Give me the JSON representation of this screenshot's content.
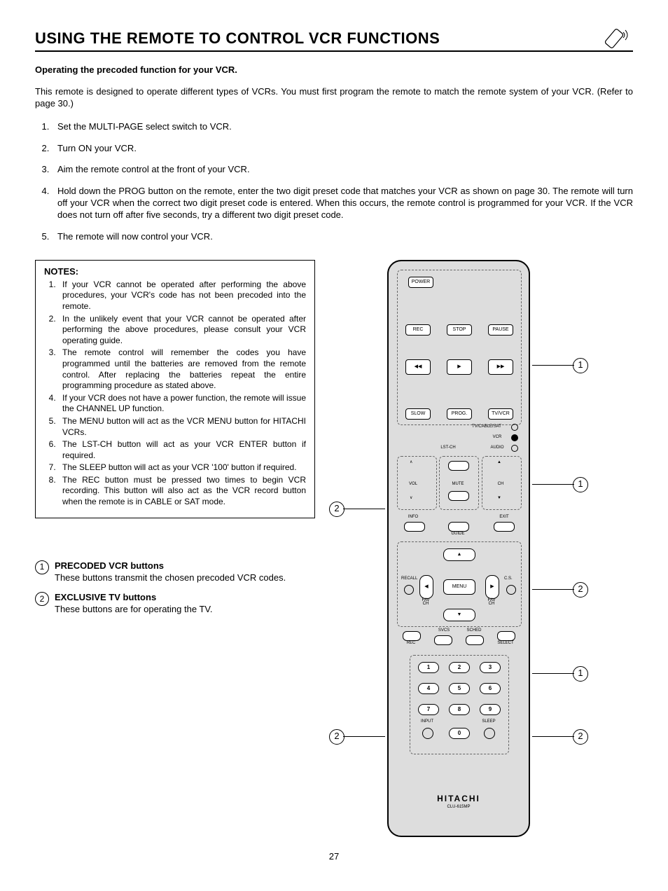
{
  "title": "USING THE REMOTE TO CONTROL VCR FUNCTIONS",
  "subhead": "Operating the precoded function for your VCR.",
  "intro": "This remote is designed to operate different types of VCRs.  You must first program the remote to match the remote system of your VCR. (Refer to page 30.)",
  "steps": [
    "Set the MULTI-PAGE select switch to VCR.",
    "Turn ON your VCR.",
    "Aim the remote control at the front of your VCR.",
    "Hold down the PROG button on the remote, enter the two digit preset code that matches your VCR as shown on page 30.  The remote will turn off your VCR when the correct two digit preset code is entered.  When this occurs, the remote control is programmed for your VCR.  If the VCR does not turn off after five seconds, try a different two digit preset code.",
    "The remote will now control your VCR."
  ],
  "notes_label": "NOTES:",
  "notes": [
    "If your VCR cannot be operated after performing the above procedures, your VCR's code has not been precoded into the remote.",
    "In the unlikely event that your VCR cannot be operated after performing the above procedures, please consult your VCR operating guide.",
    "The remote control will remember the codes you have programmed until the batteries are removed from the remote control.  After replacing the batteries repeat the entire programming procedure as stated above.",
    "If your VCR does not have a power function, the remote will issue the CHANNEL UP function.",
    "The MENU button will act as the VCR MENU button for HITACHI VCRs.",
    "The LST-CH button will act as your VCR ENTER button if required.",
    "The SLEEP button will act as your VCR '100' button if required.",
    "The REC button must be pressed two times to begin VCR recording.  This button will also act as the VCR record button when the remote is in CABLE or SAT mode."
  ],
  "legend": {
    "item1_title": "PRECODED VCR buttons",
    "item1_desc": "These buttons transmit the chosen precoded VCR codes.",
    "item2_title": "EXCLUSIVE TV buttons",
    "item2_desc": "These buttons are for operating the TV."
  },
  "remote": {
    "power": "POWER",
    "rec": "REC",
    "stop": "STOP",
    "pause": "PAUSE",
    "rew": "◀◀",
    "play": "▶",
    "ff": "▶▶",
    "slow": "SLOW",
    "prog": "PROG.",
    "tvvcr": "TV/VCR",
    "tvcablesat": "TV/CABLE/SAT",
    "vcr": "VCR",
    "audio": "AUDIO",
    "lstch": "LST-CH",
    "vol": "VOL",
    "mute": "MUTE",
    "ch": "CH",
    "info": "INFO",
    "guide": "GUIDE",
    "exit": "EXIT",
    "recall": "RECALL",
    "menu": "MENU",
    "favch": "FAV CH",
    "cs": "C.S.",
    "svcs": "SVCS",
    "sched": "SCHED",
    "rec2": "REC",
    "select": "SELECT",
    "n1": "1",
    "n2": "2",
    "n3": "3",
    "n4": "4",
    "n5": "5",
    "n6": "6",
    "n7": "7",
    "n8": "8",
    "n9": "9",
    "n0": "0",
    "input": "INPUT",
    "sleep": "SLEEP",
    "brand": "HITACHI",
    "model": "CLU-615MP"
  },
  "callouts": {
    "c1": "1",
    "c2": "2"
  },
  "pagenum": "27"
}
